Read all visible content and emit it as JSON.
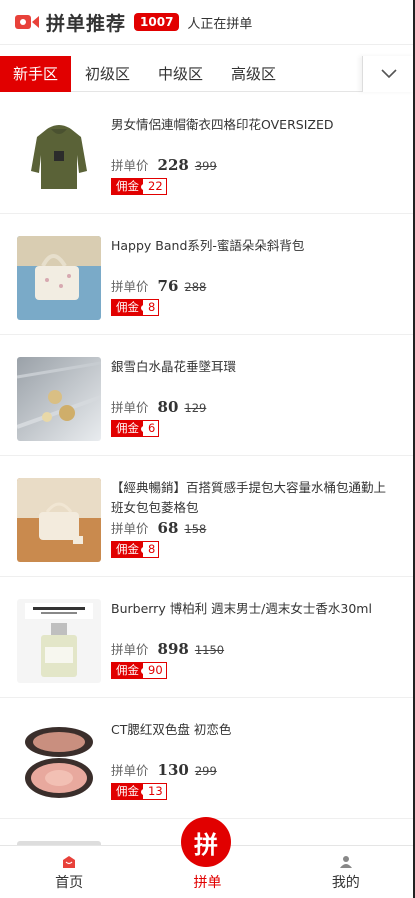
{
  "header": {
    "title": "拼单推荐",
    "count": "1007",
    "suffix": "人正在拼单"
  },
  "tabs": [
    {
      "label": "新手区",
      "active": true
    },
    {
      "label": "初级区",
      "active": false
    },
    {
      "label": "中级区",
      "active": false
    },
    {
      "label": "高级区",
      "active": false
    }
  ],
  "price_label": "拼单价",
  "commission_label": "佣金",
  "products": [
    {
      "name": "男女情侶連帽衛衣四格印花OVERSIZED",
      "price": "228",
      "orig": "399",
      "commission": "22"
    },
    {
      "name": "Happy Band系列-蜜語朵朵斜背包",
      "price": "76",
      "orig": "288",
      "commission": "8"
    },
    {
      "name": "銀雪白水晶花垂墜耳環",
      "price": "80",
      "orig": "129",
      "commission": "6"
    },
    {
      "name": "【經典暢銷】百搭質感手提包大容量水桶包通勤上班女包包菱格包",
      "price": "68",
      "orig": "158",
      "commission": "8"
    },
    {
      "name": "Burberry 博柏利 週末男士/週末女士香水30ml",
      "price": "898",
      "orig": "1150",
      "commission": "90"
    },
    {
      "name": "CT腮红双色盘 初恋色",
      "price": "130",
      "orig": "299",
      "commission": "13"
    }
  ],
  "bottom_nav": {
    "home": "首页",
    "group": "拼单",
    "center_char": "拼",
    "mine": "我的"
  },
  "colors": {
    "accent": "#e10000"
  }
}
